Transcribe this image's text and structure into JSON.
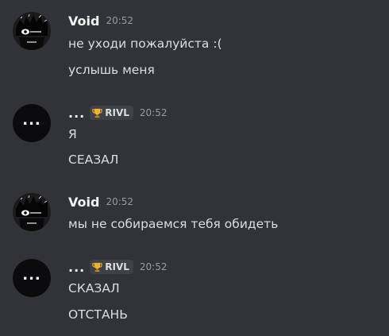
{
  "messages": [
    {
      "author": "Void",
      "time": "20:52",
      "lines": [
        "не уходи пожалуйста :(",
        "услышь меня"
      ]
    },
    {
      "author": "...",
      "tag": "RIVL",
      "avatar_text": "...",
      "time": "20:52",
      "lines": [
        "Я",
        "СЕАЗАЛ"
      ]
    },
    {
      "author": "Void",
      "time": "20:52",
      "lines": [
        "мы не собираемся тебя обидеть"
      ]
    },
    {
      "author": "...",
      "tag": "RIVL",
      "avatar_text": "...",
      "time": "20:52",
      "lines": [
        "СКАЗАЛ",
        "ОТСТАНЬ"
      ]
    }
  ],
  "icons": {
    "tag_icon": "trophy-icon"
  },
  "colors": {
    "background": "#313338",
    "username": "#f2f3f5",
    "message_text": "#dbdee1",
    "timestamp": "#949ba4",
    "tag_background": "#3f4147",
    "trophy": "#f0b232"
  }
}
